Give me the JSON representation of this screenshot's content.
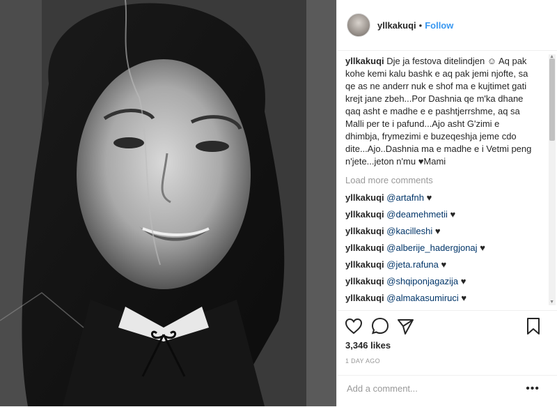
{
  "post": {
    "username": "yllkakuqi",
    "follow_label": "Follow",
    "separator": "•",
    "caption_user": "yllkakuqi",
    "caption_text": "Dje ja festova ditelindjen ☺ Aq pak kohe kemi kalu bashk e aq pak jemi njofte, sa qe as ne anderr nuk e shof ma e kujtimet gati krejt jane zbeh...Por Dashnia qe m'ka dhane qaq asht e madhe e e pashtjerrshme, aq sa Malli per te i pafund...Ajo asht G'zimi e dhimbja, frymezimi e buzeqeshja jeme cdo dite...Ajo..Dashnia ma e madhe e i Vetmi peng n'jete...jeton n'mu ♥Mami",
    "load_more": "Load more comments",
    "comments": [
      {
        "user": "yllkakuqi",
        "mention": "@artafnh",
        "heart": "♥"
      },
      {
        "user": "yllkakuqi",
        "mention": "@deamehmetii",
        "heart": "♥"
      },
      {
        "user": "yllkakuqi",
        "mention": "@kacilleshi",
        "heart": "♥"
      },
      {
        "user": "yllkakuqi",
        "mention": "@alberije_hadergjonaj",
        "heart": "♥"
      },
      {
        "user": "yllkakuqi",
        "mention": "@jeta.rafuna",
        "heart": "♥"
      },
      {
        "user": "yllkakuqi",
        "mention": "@shqiponjagazija",
        "heart": "♥"
      },
      {
        "user": "yllkakuqi",
        "mention": "@almakasumiruci",
        "heart": "♥"
      }
    ],
    "likes": "3,346 likes",
    "time_ago": "1 DAY AGO",
    "add_comment_placeholder": "Add a comment...",
    "more_options": "•••"
  },
  "icons": {
    "like": "heart-icon",
    "comment": "comment-icon",
    "share": "share-icon",
    "save": "bookmark-icon"
  },
  "colors": {
    "link": "#3897f0",
    "mention": "#003569",
    "muted": "#999999"
  }
}
